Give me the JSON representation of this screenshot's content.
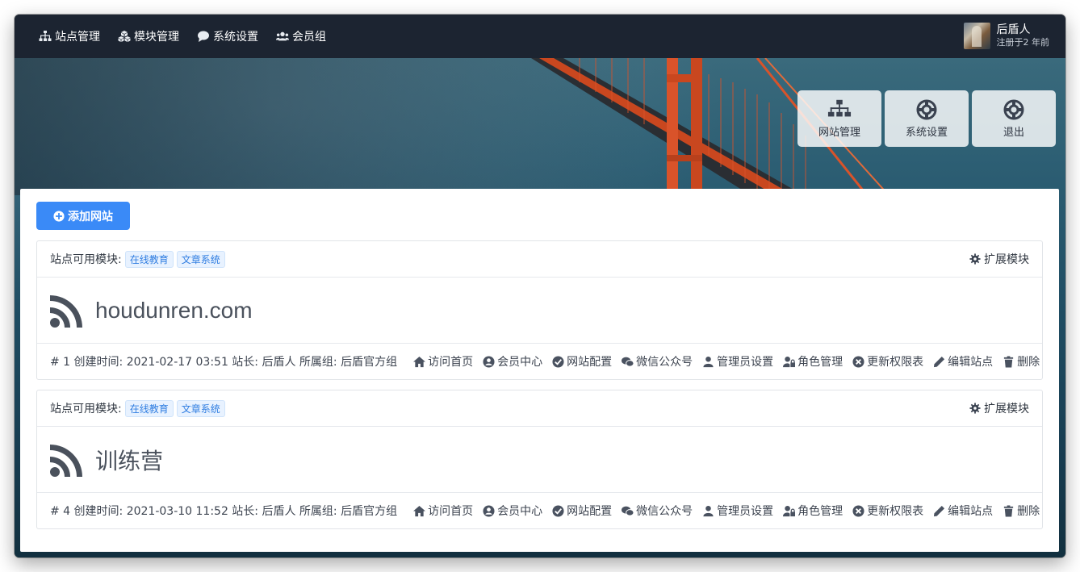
{
  "nav": {
    "items": [
      {
        "label": "站点管理",
        "icon": "sitemap-icon"
      },
      {
        "label": "模块管理",
        "icon": "cubes-icon"
      },
      {
        "label": "系统设置",
        "icon": "comment-icon"
      },
      {
        "label": "会员组",
        "icon": "users-icon"
      }
    ],
    "user": {
      "name": "后盾人",
      "registered": "注册于2 年前"
    }
  },
  "quick_buttons": [
    {
      "label": "网站管理",
      "icon": "sitemap-icon"
    },
    {
      "label": "系统设置",
      "icon": "life-ring-icon"
    },
    {
      "label": "退出",
      "icon": "life-ring-icon"
    }
  ],
  "add_button": "添加网站",
  "sites": [
    {
      "modules_label": "站点可用模块:",
      "modules": [
        "在线教育",
        "文章系统"
      ],
      "ext_label": "扩展模块",
      "name": "houdunren.com",
      "meta": "# 1 创建时间: 2021-02-17 03:51 站长: 后盾人 所属组: 后盾官方组",
      "actions": [
        "访问首页",
        "会员中心",
        "网站配置",
        "微信公众号",
        "管理员设置",
        "角色管理",
        "更新权限表",
        "编辑站点",
        "删除"
      ]
    },
    {
      "modules_label": "站点可用模块:",
      "modules": [
        "在线教育",
        "文章系统"
      ],
      "ext_label": "扩展模块",
      "name": "训练营",
      "meta": "# 4 创建时间: 2021-03-10 11:52 站长: 后盾人 所属组: 后盾官方组",
      "actions": [
        "访问首页",
        "会员中心",
        "网站配置",
        "微信公众号",
        "管理员设置",
        "角色管理",
        "更新权限表",
        "编辑站点",
        "删除"
      ]
    }
  ],
  "colors": {
    "primary": "#3a8af7",
    "nav_bg": "#1c2431",
    "badge_text": "#2f7de1",
    "bridge": "#d9532a"
  }
}
